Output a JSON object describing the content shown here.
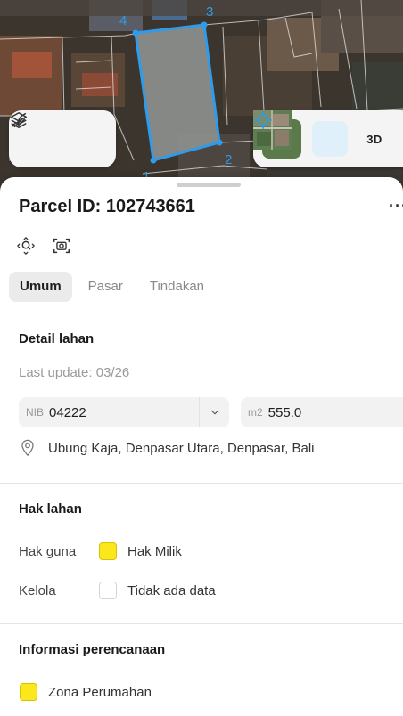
{
  "map": {
    "vertex_labels": [
      "1",
      "2",
      "3",
      "4"
    ],
    "parcel_color": "#2f9bea",
    "layers_icon": "layers-icon",
    "draw_icon": "draw-icon",
    "locate_icon": "crosshair-icon",
    "view_3d_label": "3D"
  },
  "sheet": {
    "title": "Parcel ID: 102743661",
    "more_label": "···",
    "tabs": [
      {
        "label": "Umum",
        "active": true
      },
      {
        "label": "Pasar",
        "active": false
      },
      {
        "label": "Tindakan",
        "active": false
      }
    ],
    "detail": {
      "title": "Detail lahan",
      "last_update": "Last update: 03/26",
      "nib_prefix": "NIB",
      "nib_value": "04222",
      "area_prefix": "m2",
      "area_value": "555.0",
      "address": "Ubung Kaja, Denpasar Utara, Denpasar, Bali"
    },
    "rights": {
      "title": "Hak lahan",
      "rows": [
        {
          "key": "Hak guna",
          "value": "Hak Milik",
          "swatch": "#fbe71c"
        },
        {
          "key": "Kelola",
          "value": "Tidak ada data",
          "swatch": "#ffffff"
        }
      ]
    },
    "planning": {
      "title": "Informasi perencanaan",
      "zone": "Zona Perumahan",
      "zone_color": "#fbe71c"
    }
  }
}
